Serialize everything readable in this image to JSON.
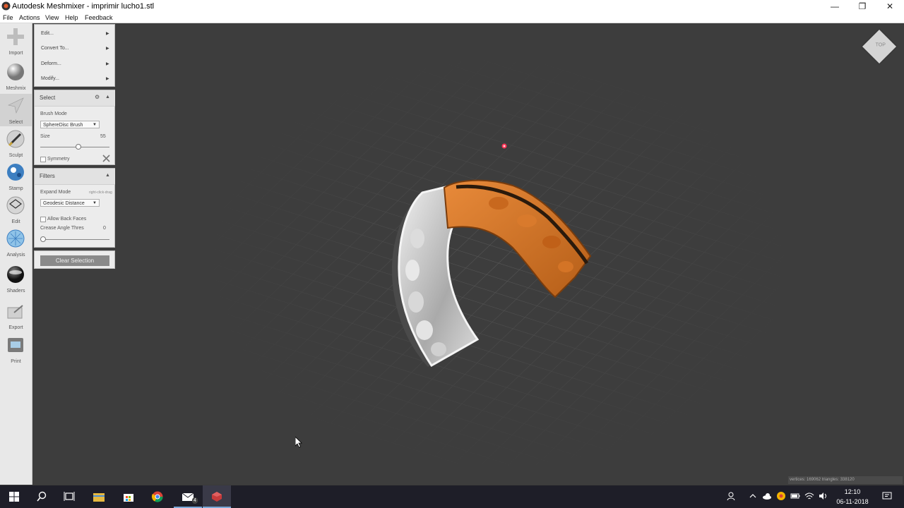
{
  "window": {
    "title": "Autodesk Meshmixer - imprimir lucho1.stl",
    "minimize": "—",
    "maximize": "❐",
    "close": "✕"
  },
  "menu": {
    "file": "File",
    "actions": "Actions",
    "view": "View",
    "help": "Help",
    "feedback": "Feedback"
  },
  "tools": [
    {
      "label": "Import",
      "icon": "plus-icon"
    },
    {
      "label": "Meshmix",
      "icon": "sphere-icon"
    },
    {
      "label": "Select",
      "icon": "select-arrow-icon"
    },
    {
      "label": "Sculpt",
      "icon": "brush-icon"
    },
    {
      "label": "Stamp",
      "icon": "stamp-icon"
    },
    {
      "label": "Edit",
      "icon": "edit-icon"
    },
    {
      "label": "Analysis",
      "icon": "analysis-icon"
    },
    {
      "label": "Shaders",
      "icon": "shader-ball-icon"
    },
    {
      "label": "Export",
      "icon": "export-icon"
    },
    {
      "label": "Print",
      "icon": "print-icon"
    }
  ],
  "submenu": {
    "items": [
      {
        "label": "Edit..."
      },
      {
        "label": "Convert To..."
      },
      {
        "label": "Deform..."
      },
      {
        "label": "Modify..."
      }
    ],
    "arrow": "▶"
  },
  "select_panel": {
    "title": "Select",
    "brush_mode_label": "Brush Mode",
    "brush_mode_value": "SphereDisc Brush",
    "size_label": "Size",
    "size_value": "55",
    "size_fraction": 0.55,
    "symmetry_label": "Symmetry"
  },
  "filters_panel": {
    "title": "Filters",
    "expand_mode_label": "Expand Mode",
    "expand_mode_hint": "right-click-drag",
    "expand_mode_value": "Geodesic Distance",
    "allow_back_faces_label": "Allow Back Faces",
    "crease_angle_label": "Crease Angle Thres",
    "crease_angle_value": "0",
    "crease_fraction": 0.0
  },
  "clear_selection_label": "Clear Selection",
  "view_cube_label": "TOP",
  "stats": "vertices: 169062 triangles: 338120",
  "taskbar": {
    "time": "12:10",
    "date": "06-11-2018",
    "mail_badge": "4"
  },
  "colors": {
    "selection": "#d4731f",
    "mesh": "#c9c9c9",
    "viewport": "#3d3d3d"
  }
}
